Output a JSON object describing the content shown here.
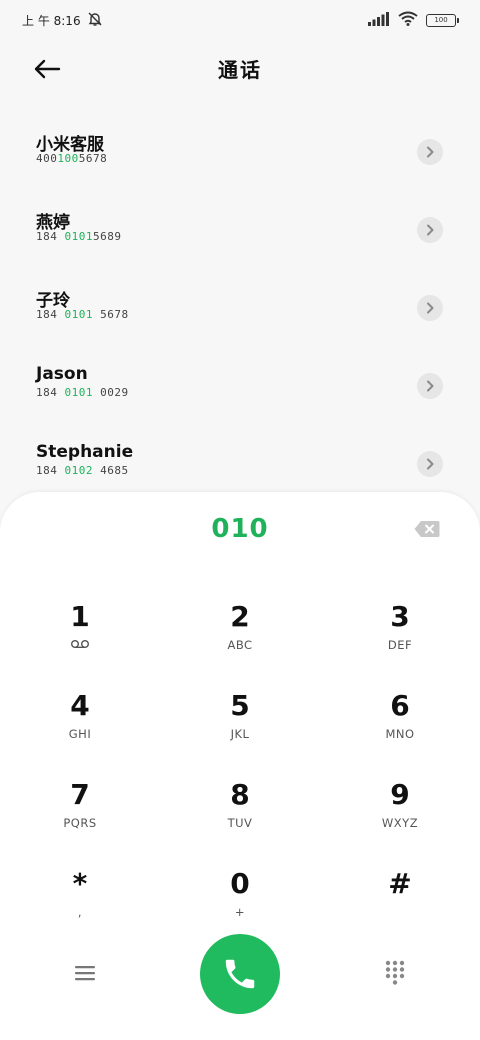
{
  "status_bar": {
    "time": "上 午 8:16",
    "battery": "100"
  },
  "header": {
    "title": "通话"
  },
  "contacts": [
    {
      "name": "小米客服",
      "number_pre": "400",
      "number_hl": "100",
      "number_post": "5678"
    },
    {
      "name": "燕婷",
      "number_pre": "184 ",
      "number_hl": "0101",
      "number_post": "5689"
    },
    {
      "name": "子玲",
      "number_pre": "184 ",
      "number_hl": "0101",
      "number_post": " 5678"
    },
    {
      "name": "Jason",
      "number_pre": "184 ",
      "number_hl": "0101",
      "number_post": " 0029"
    },
    {
      "name": "Stephanie",
      "number_pre": "184 ",
      "number_hl": "0102",
      "number_post": " 4685"
    }
  ],
  "dialer": {
    "input_value": "010",
    "keys": [
      {
        "digit": "1",
        "letters": "voicemail"
      },
      {
        "digit": "2",
        "letters": "ABC"
      },
      {
        "digit": "3",
        "letters": "DEF"
      },
      {
        "digit": "4",
        "letters": "GHI"
      },
      {
        "digit": "5",
        "letters": "JKL"
      },
      {
        "digit": "6",
        "letters": "MNO"
      },
      {
        "digit": "7",
        "letters": "PQRS"
      },
      {
        "digit": "8",
        "letters": "TUV"
      },
      {
        "digit": "9",
        "letters": "WXYZ"
      },
      {
        "digit": "*",
        "letters": ","
      },
      {
        "digit": "0",
        "letters": "+"
      },
      {
        "digit": "#",
        "letters": ""
      }
    ]
  },
  "colors": {
    "accent": "#1fb25a",
    "call_button": "#1fbb5e"
  }
}
